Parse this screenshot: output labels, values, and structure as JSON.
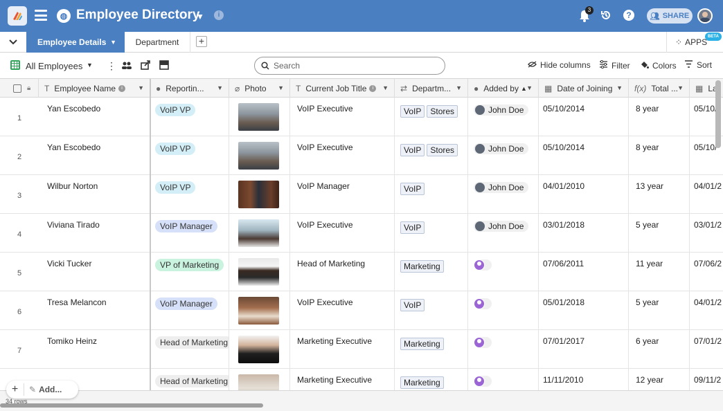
{
  "header": {
    "title": "Employee Directory",
    "notification_count": "3",
    "share_label": "SHARE",
    "brand_color": "#4a7fc1"
  },
  "tabs": {
    "active": "Employee Details",
    "second": "Department",
    "apps_label": "APPS",
    "beta_label": "BETA"
  },
  "toolbar": {
    "view_name": "All Employees",
    "search_placeholder": "Search",
    "hide_columns": "Hide columns",
    "filter": "Filter",
    "colors": "Colors",
    "sort": "Sort"
  },
  "columns": {
    "name": "Employee Name",
    "reporting": "Reportin...",
    "photo": "Photo",
    "job_title": "Current Job Title",
    "department": "Departm...",
    "added_by": "Added by",
    "joining": "Date of Joining",
    "total": "Total ...",
    "last": "La"
  },
  "rows": [
    {
      "num": "1",
      "name": "Yan Escobedo",
      "reporting": "VoIP VP",
      "job": "VoIP Executive",
      "depts": [
        "VoIP",
        "Stores"
      ],
      "added_by": "John Doe",
      "joining": "05/10/2014",
      "total": "8 year",
      "last": "05/10/"
    },
    {
      "num": "2",
      "name": "Yan Escobedo",
      "reporting": "VoIP VP",
      "job": "VoIP Executive",
      "depts": [
        "VoIP",
        "Stores"
      ],
      "added_by": "John Doe",
      "joining": "05/10/2014",
      "total": "8 year",
      "last": "05/10/"
    },
    {
      "num": "3",
      "name": "Wilbur Norton",
      "reporting": "VoIP VP",
      "job": "VoIP Manager",
      "depts": [
        "VoIP"
      ],
      "added_by": "John Doe",
      "joining": "04/01/2010",
      "total": "13 year",
      "last": "04/01/2"
    },
    {
      "num": "4",
      "name": "Viviana Tirado",
      "reporting": "VoIP Manager",
      "job": "VoIP Executive",
      "depts": [
        "VoIP"
      ],
      "added_by": "John Doe",
      "joining": "03/01/2018",
      "total": "5 year",
      "last": "03/01/2"
    },
    {
      "num": "5",
      "name": "Vicki Tucker",
      "reporting": "VP of Marketing",
      "job": "Head of Marketing",
      "depts": [
        "Marketing"
      ],
      "added_by": "",
      "joining": "07/06/2011",
      "total": "11 year",
      "last": "07/06/2"
    },
    {
      "num": "6",
      "name": "Tresa Melancon",
      "reporting": "VoIP Manager",
      "job": "VoIP Executive",
      "depts": [
        "VoIP"
      ],
      "added_by": "",
      "joining": "05/01/2018",
      "total": "5 year",
      "last": "04/01/2"
    },
    {
      "num": "7",
      "name": "Tomiko Heinz",
      "reporting": "Head of Marketing",
      "job": "Marketing Executive",
      "depts": [
        "Marketing"
      ],
      "added_by": "",
      "joining": "07/01/2017",
      "total": "6 year",
      "last": "07/01/2"
    },
    {
      "num": "",
      "name": "",
      "reporting": "Head of Marketing",
      "job": "Marketing Executive",
      "depts": [
        "Marketing"
      ],
      "added_by": "",
      "joining": "11/11/2010",
      "total": "12 year",
      "last": "09/11/2"
    }
  ],
  "footer": {
    "add_label": "Add...",
    "row_count": "34 rows"
  },
  "colors": {
    "pill_voip_vp": "#d3eef6",
    "pill_voip_manager": "#d6e0f8",
    "pill_vp_marketing": "#c9f2df",
    "pill_head_marketing": "#eeeeee"
  }
}
